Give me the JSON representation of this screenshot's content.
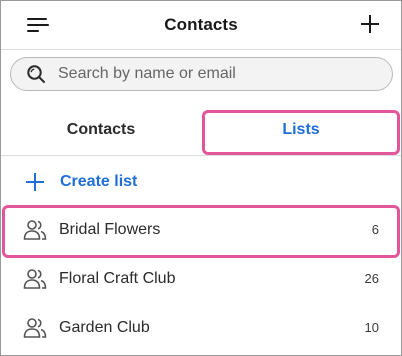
{
  "header": {
    "title": "Contacts"
  },
  "search": {
    "placeholder": "Search by name or email"
  },
  "tabs": [
    {
      "label": "Contacts",
      "selected": false
    },
    {
      "label": "Lists",
      "selected": true
    }
  ],
  "create_list": {
    "label": "Create list"
  },
  "lists": [
    {
      "name": "Bridal Flowers",
      "count": "6"
    },
    {
      "name": "Floral Craft Club",
      "count": "26"
    },
    {
      "name": "Garden Club",
      "count": "10"
    }
  ],
  "colors": {
    "accent": "#1f6fd6",
    "highlight": "#e3579a",
    "text": "#2b2b2b"
  },
  "icons": {
    "menu": "hamburger-icon",
    "add": "plus-icon",
    "search": "search-icon",
    "list": "people-icon"
  }
}
